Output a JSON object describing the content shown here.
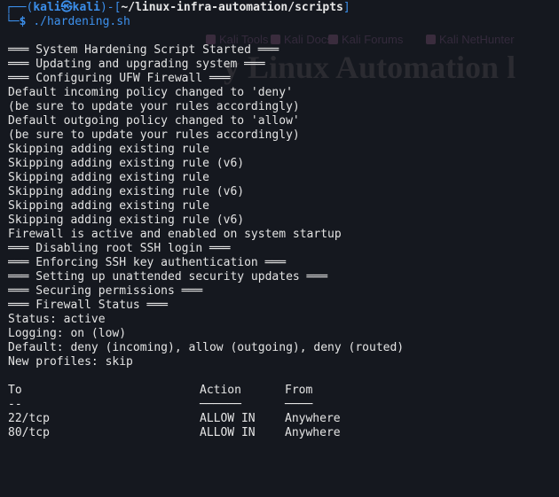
{
  "colors": {
    "background": "#15181f",
    "prompt_blue": "#3b8eea",
    "text": "#e4e4e4",
    "ghost_text": "#342a3c"
  },
  "prompt": {
    "corner": "┌──(",
    "user": "kali㉿kali",
    "sep": ")-[",
    "path": "~/linux-infra-automation/scripts",
    "close": "]",
    "corner2": "└─",
    "dollar": "$",
    "command": "./hardening.sh"
  },
  "background_browser": {
    "bookmarks": [
      "Kali Tools",
      "Kali Docs",
      "Kali Forums",
      "Kali NetHunter"
    ],
    "heading_fragment": "y Linux Automation l"
  },
  "output_lines": [
    "═══ System Hardening Script Started ═══",
    "═══ Updating and upgrading system ═══",
    "═══ Configuring UFW Firewall ═══",
    "Default incoming policy changed to 'deny'",
    "(be sure to update your rules accordingly)",
    "Default outgoing policy changed to 'allow'",
    "(be sure to update your rules accordingly)",
    "Skipping adding existing rule",
    "Skipping adding existing rule (v6)",
    "Skipping adding existing rule",
    "Skipping adding existing rule (v6)",
    "Skipping adding existing rule",
    "Skipping adding existing rule (v6)",
    "Firewall is active and enabled on system startup",
    "═══ Disabling root SSH login ═══",
    "═══ Enforcing SSH key authentication ═══",
    "═══ Setting up unattended security updates ═══",
    "═══ Securing permissions ═══",
    "═══ Firewall Status ═══",
    "Status: active",
    "Logging: on (low)",
    "Default: deny (incoming), allow (outgoing), deny (routed)",
    "New profiles: skip",
    ""
  ],
  "ufw_table": {
    "headers": [
      "To",
      "Action",
      "From"
    ],
    "separators": [
      "--",
      "──────",
      "────"
    ],
    "rows": [
      [
        "22/tcp",
        "ALLOW IN",
        "Anywhere"
      ],
      [
        "80/tcp",
        "ALLOW IN",
        "Anywhere"
      ]
    ]
  }
}
